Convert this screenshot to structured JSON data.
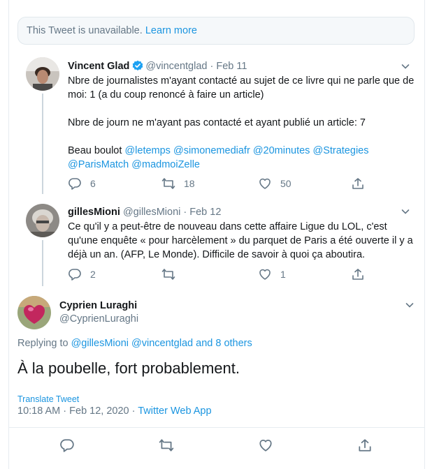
{
  "notice": {
    "text": "This Tweet is unavailable.",
    "link": "Learn more"
  },
  "tweets": [
    {
      "name": "Vincent Glad",
      "verified": true,
      "handle": "@vincentglad",
      "date": "Feb 11",
      "paragraphs": [
        "Nbre de journalistes m'ayant contacté au sujet de ce livre qui ne parle que de moi: 1 (a du coup renoncé à faire un article)",
        "Nbre de journ ne m'ayant pas contacté et ayant publié un article: 7"
      ],
      "closing_text": "Beau boulot",
      "mentions": [
        "@letemps",
        "@simonemediafr",
        "@20minutes",
        "@Strategies",
        "@ParisMatch",
        "@madmoiZelle"
      ],
      "replies": "6",
      "retweets": "18",
      "likes": "50"
    },
    {
      "name": "gillesMioni",
      "handle": "@gillesMioni",
      "date": "Feb 12",
      "text": "Ce qu'il y a peut-être de nouveau dans cette affaire Ligue du LOL, c'est qu'une enquête « pour harcèlement » du parquet de Paris a été ouverte il y a déjà un an. (AFP, Le Monde). Difficile de savoir à quoi ça aboutira.",
      "replies": "2",
      "likes": "1"
    }
  ],
  "focused": {
    "name": "Cyprien Luraghi",
    "handle": "@CyprienLuraghi",
    "replying_prefix": "Replying to",
    "replying_mentions": "@gillesMioni @vincentglad",
    "replying_suffix": "and 8 others",
    "text": "À la poubelle, fort probablement.",
    "translate": "Translate Tweet",
    "timestamp": "10:18 AM · Feb 12, 2020 ·",
    "source": "Twitter Web App"
  },
  "colors": {
    "accent": "#1b95e0",
    "secondary": "#657786",
    "border": "#e6ecf0"
  }
}
